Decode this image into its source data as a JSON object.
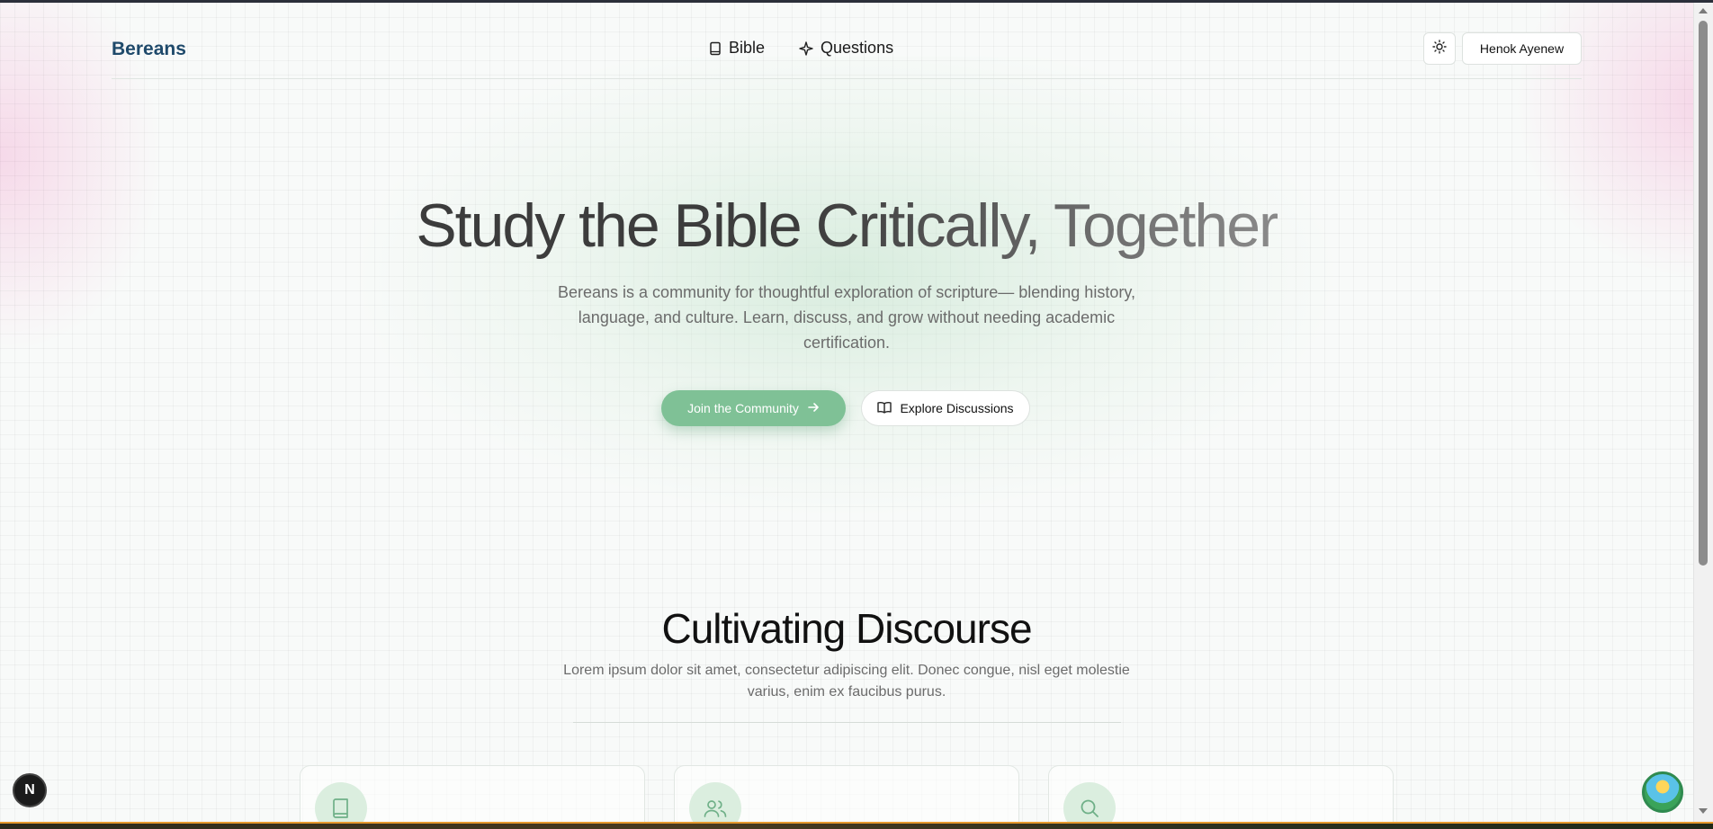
{
  "header": {
    "brand": "Bereans",
    "nav": [
      {
        "label": "Bible",
        "icon": "book-icon"
      },
      {
        "label": "Questions",
        "icon": "sparkle-icon"
      }
    ],
    "theme_toggle_icon": "sun-icon",
    "user_name": "Henok Ayenew"
  },
  "hero": {
    "title": "Study the Bible Critically, Together",
    "subtitle": "Bereans is a community for thoughtful exploration of scripture— blending history, language, and culture. Learn, discuss, and grow without needing academic certification.",
    "primary_cta": "Join the Community",
    "primary_cta_icon": "arrow-right-icon",
    "secondary_cta": "Explore Discussions",
    "secondary_cta_icon": "open-book-icon"
  },
  "section": {
    "title": "Cultivating Discourse",
    "subtitle": "Lorem ipsum dolor sit amet, consectetur adipiscing elit. Donec congue, nisl eget molestie varius, enim ex faucibus purus.",
    "cards": [
      {
        "icon": "book-icon"
      },
      {
        "icon": "users-icon"
      },
      {
        "icon": "search-icon"
      }
    ]
  },
  "overlay": {
    "next_badge": "N"
  },
  "colors": {
    "brand": "#1f4a6b",
    "accent": "#7fc196",
    "accent_soft": "#dbeedf"
  }
}
